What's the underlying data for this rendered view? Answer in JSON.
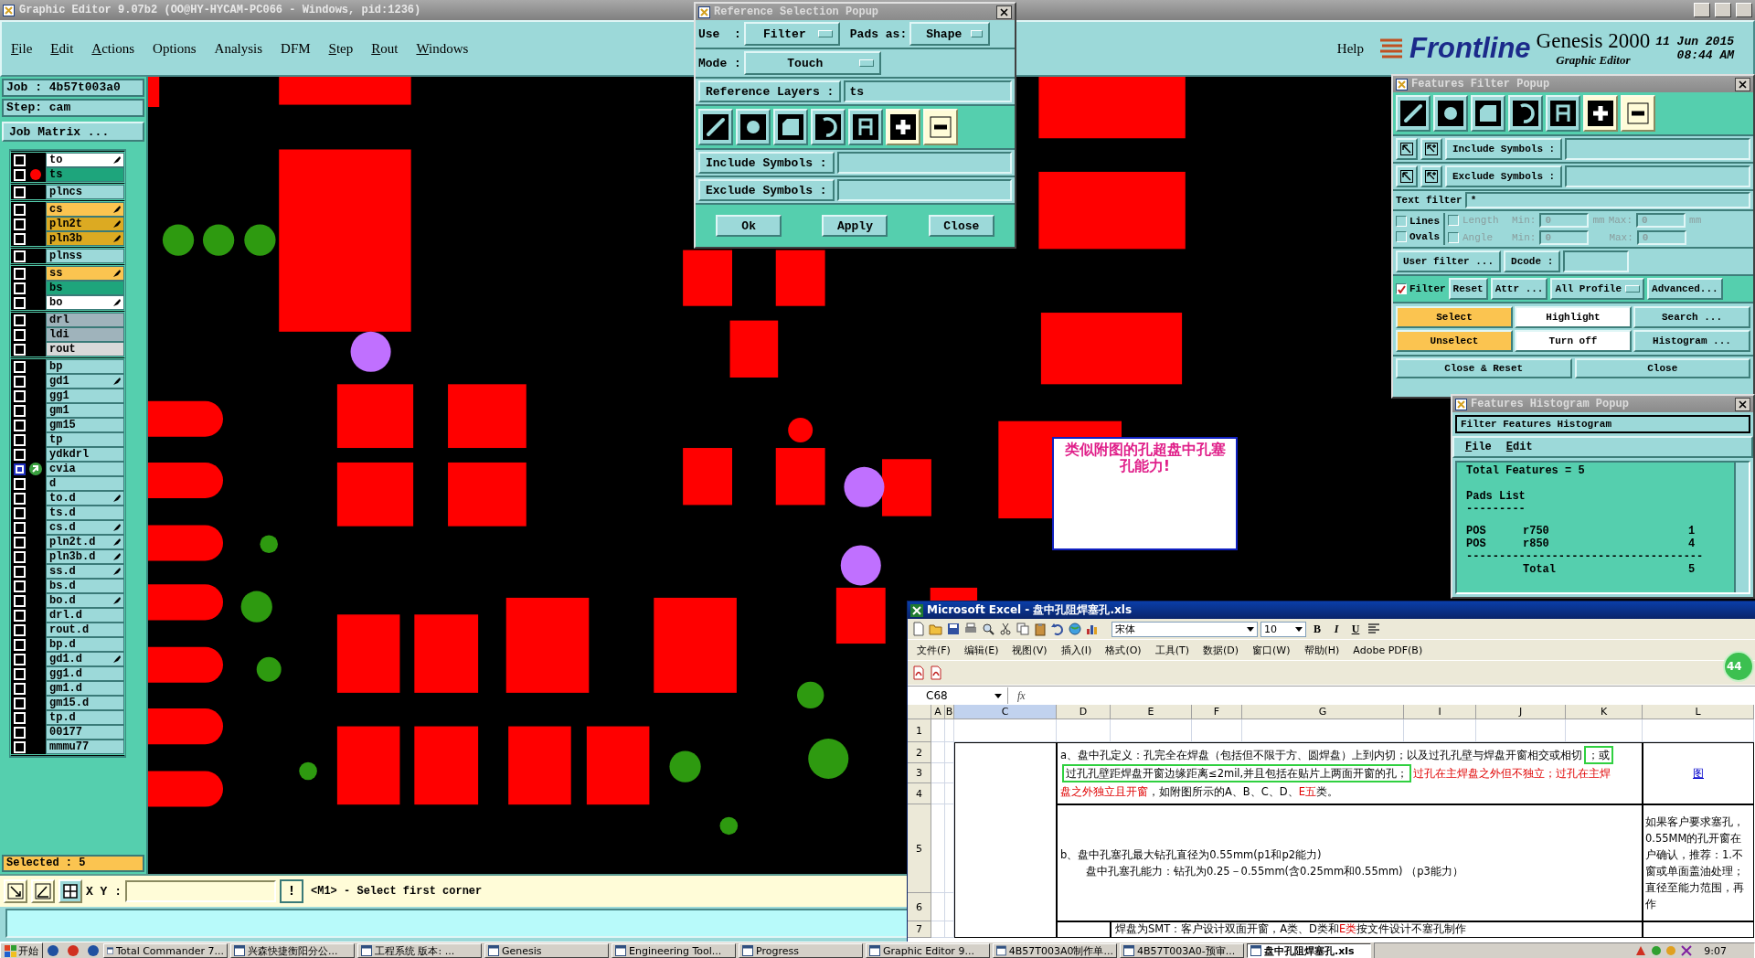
{
  "main_window": {
    "title": "Graphic Editor 9.07b2 (OO@HY-HYCAM-PC066 - Windows, pid:1236)"
  },
  "menu": [
    {
      "label": "File",
      "underlined": true
    },
    {
      "label": "Edit",
      "underlined": true
    },
    {
      "label": "Actions",
      "underlined": true
    },
    {
      "label": "Options",
      "underlined": false
    },
    {
      "label": "Analysis",
      "underlined": false
    },
    {
      "label": "DFM",
      "underlined": false
    },
    {
      "label": "Step",
      "underlined": true
    },
    {
      "label": "Rout",
      "underlined": true
    },
    {
      "label": "Windows",
      "underlined": true
    }
  ],
  "help": "Help",
  "brand": {
    "logo": "Frontline",
    "product": "Genesis 2000",
    "subtitle": "Graphic Editor",
    "date": "11 Jun 2015",
    "time": "08:44 AM"
  },
  "job": {
    "job": "Job : 4b57t003a0",
    "step": "Step: cam",
    "matrix_button": "Job Matrix ..."
  },
  "layer_groups": [
    {
      "layers": [
        {
          "name": "to",
          "color": "#ffffff",
          "work": false,
          "displayed": false,
          "marked": true
        },
        {
          "name": "ts",
          "color": "#1ea57c",
          "work": true,
          "displayed": false,
          "marked": false
        }
      ]
    },
    {
      "layers": [
        {
          "name": "plncs",
          "color": "#9cd9d9",
          "work": false,
          "displayed": false,
          "marked": false
        }
      ]
    },
    {
      "layers": [
        {
          "name": "cs",
          "color": "#fbc450",
          "work": false,
          "displayed": false,
          "marked": true
        },
        {
          "name": "pln2t",
          "color": "#dcaa22",
          "work": false,
          "displayed": false,
          "marked": true
        },
        {
          "name": "pln3b",
          "color": "#dcaa22",
          "work": false,
          "displayed": false,
          "marked": true
        }
      ]
    },
    {
      "layers": [
        {
          "name": "plnss",
          "color": "#9cd9d9",
          "work": false,
          "displayed": false,
          "marked": false
        }
      ]
    },
    {
      "layers": [
        {
          "name": "ss",
          "color": "#fbc450",
          "work": false,
          "displayed": false,
          "marked": true
        },
        {
          "name": "bs",
          "color": "#1ea57c",
          "work": false,
          "displayed": false,
          "marked": false
        },
        {
          "name": "bo",
          "color": "#ffffff",
          "work": false,
          "displayed": false,
          "marked": true
        }
      ]
    },
    {
      "layers": [
        {
          "name": "drl",
          "color": "#9fb3bb",
          "work": false,
          "displayed": false,
          "marked": false
        },
        {
          "name": "ldi",
          "color": "#9fb3bb",
          "work": false,
          "displayed": false,
          "marked": false
        },
        {
          "name": "rout",
          "color": "#d9d9d9",
          "work": false,
          "displayed": false,
          "marked": false
        }
      ]
    },
    {
      "layers": [
        {
          "name": "bp",
          "color": "#9cd9d9",
          "work": false,
          "displayed": false,
          "marked": false
        },
        {
          "name": "gd1",
          "color": "#9cd9d9",
          "work": false,
          "displayed": false,
          "marked": true
        },
        {
          "name": "gg1",
          "color": "#9cd9d9",
          "work": false,
          "displayed": false,
          "marked": false
        },
        {
          "name": "gm1",
          "color": "#9cd9d9",
          "work": false,
          "displayed": false,
          "marked": false
        },
        {
          "name": "gm15",
          "color": "#9cd9d9",
          "work": false,
          "displayed": false,
          "marked": false
        },
        {
          "name": "tp",
          "color": "#9cd9d9",
          "work": false,
          "displayed": false,
          "marked": false
        },
        {
          "name": "ydkdrl",
          "color": "#9cd9d9",
          "work": false,
          "displayed": false,
          "marked": false
        },
        {
          "name": "cvia",
          "color": "#9cd9d9",
          "work": false,
          "displayed": true,
          "marked": false
        },
        {
          "name": "d",
          "color": "#9cd9d9",
          "work": false,
          "displayed": false,
          "marked": false
        },
        {
          "name": "to.d",
          "color": "#9cd9d9",
          "work": false,
          "displayed": false,
          "marked": true
        },
        {
          "name": "ts.d",
          "color": "#9cd9d9",
          "work": false,
          "displayed": false,
          "marked": false
        },
        {
          "name": "cs.d",
          "color": "#9cd9d9",
          "work": false,
          "displayed": false,
          "marked": true
        },
        {
          "name": "pln2t.d",
          "color": "#9cd9d9",
          "work": false,
          "displayed": false,
          "marked": true
        },
        {
          "name": "pln3b.d",
          "color": "#9cd9d9",
          "work": false,
          "displayed": false,
          "marked": true
        },
        {
          "name": "ss.d",
          "color": "#9cd9d9",
          "work": false,
          "displayed": false,
          "marked": true
        },
        {
          "name": "bs.d",
          "color": "#9cd9d9",
          "work": false,
          "displayed": false,
          "marked": false
        },
        {
          "name": "bo.d",
          "color": "#9cd9d9",
          "work": false,
          "displayed": false,
          "marked": true
        },
        {
          "name": "drl.d",
          "color": "#9cd9d9",
          "work": false,
          "displayed": false,
          "marked": false
        },
        {
          "name": "rout.d",
          "color": "#9cd9d9",
          "work": false,
          "displayed": false,
          "marked": false
        },
        {
          "name": "bp.d",
          "color": "#9cd9d9",
          "work": false,
          "displayed": false,
          "marked": false
        },
        {
          "name": "gd1.d",
          "color": "#9cd9d9",
          "work": false,
          "displayed": false,
          "marked": true
        },
        {
          "name": "gg1.d",
          "color": "#9cd9d9",
          "work": false,
          "displayed": false,
          "marked": false
        },
        {
          "name": "gm1.d",
          "color": "#9cd9d9",
          "work": false,
          "displayed": false,
          "marked": false
        },
        {
          "name": "gm15.d",
          "color": "#9cd9d9",
          "work": false,
          "displayed": false,
          "marked": false
        },
        {
          "name": "tp.d",
          "color": "#9cd9d9",
          "work": false,
          "displayed": false,
          "marked": false
        },
        {
          "name": "00177",
          "color": "#9cd9d9",
          "work": false,
          "displayed": false,
          "marked": false
        },
        {
          "name": "mmmu77",
          "color": "#9cd9d9",
          "work": false,
          "displayed": false,
          "marked": false
        }
      ]
    }
  ],
  "selected": "Selected : 5",
  "canvas_note": "类似附图的孔超盘中孔塞孔能力!",
  "command_bar": {
    "xy_label": "X Y :",
    "alert": "!",
    "prompt": "<M1> - Select first corner"
  },
  "reference_popup": {
    "title": "Reference Selection Popup",
    "use_label": "Use  :",
    "use_value": "Filter",
    "pads_label": "Pads as:",
    "pads_value": "Shape",
    "mode_label": "Mode :",
    "mode_value": "Touch",
    "layers_button": "Reference Layers :",
    "layers_value": "ts",
    "types": [
      {
        "kind": "line"
      },
      {
        "kind": "pad"
      },
      {
        "kind": "surface"
      },
      {
        "kind": "arc"
      },
      {
        "kind": "text"
      },
      {
        "kind": "positive"
      },
      {
        "kind": "negative"
      }
    ],
    "include_button": "Include Symbols :",
    "exclude_button": "Exclude Symbols :",
    "buttons": [
      "Ok",
      "Apply",
      "Close"
    ]
  },
  "filter_popup": {
    "title": "Features Filter Popup",
    "types": [
      {
        "kind": "line"
      },
      {
        "kind": "pad"
      },
      {
        "kind": "surface"
      },
      {
        "kind": "arc"
      },
      {
        "kind": "text"
      },
      {
        "kind": "positive"
      },
      {
        "kind": "negative"
      }
    ],
    "include_label": "Include Symbols :",
    "exclude_label": "Exclude Symbols :",
    "text_filter_label": "Text filter",
    "text_filter_value": "*",
    "lines": {
      "label": "Lines",
      "checked": false
    },
    "ovals": {
      "label": "Ovals",
      "checked": false
    },
    "length": {
      "label": "Length",
      "checked": false,
      "disabled": true,
      "min_label": "Min:",
      "min": "0",
      "min_unit": "mm",
      "max_label": "Max:",
      "max": "0",
      "max_unit": "mm"
    },
    "angle": {
      "label": "Angle",
      "checked": false,
      "disabled": true,
      "min_label": "Min:",
      "min": "0",
      "max_label": "Max:",
      "max": "0"
    },
    "user_filter": "User filter ...",
    "dcode_label": "Dcode :",
    "filter": {
      "label": "Filter",
      "checked": true
    },
    "reset": "Reset",
    "attr": "Attr ...",
    "profile": "All Profile",
    "advanced": "Advanced...",
    "actions": [
      {
        "label": "Select",
        "kind": "primary"
      },
      {
        "label": "Highlight",
        "kind": "plain"
      },
      {
        "label": "Search ...",
        "kind": "normal"
      },
      {
        "label": "Unselect",
        "kind": "primary"
      },
      {
        "label": "Turn off",
        "kind": "plain"
      },
      {
        "label": "Histogram ...",
        "kind": "normal"
      }
    ],
    "close_reset": "Close & Reset",
    "close": "Close"
  },
  "histogram_popup": {
    "title": "Features Histogram Popup",
    "heading": "Filter Features Histogram",
    "menu": [
      "File",
      "Edit"
    ],
    "total": "Total Features = 5",
    "section": "Pads List",
    "section_rule": "---------",
    "rows": [
      {
        "type": "POS",
        "symbol": "r750",
        "count": "1"
      },
      {
        "type": "POS",
        "symbol": "r850",
        "count": "4"
      }
    ],
    "rule": "------------------------------------",
    "total_label": "Total",
    "total_count": "5"
  },
  "excel": {
    "title": "Microsoft Excel - 盘中孔阻焊塞孔.xls",
    "font": "宋体",
    "font_size": "10",
    "format_buttons": [
      "B",
      "I",
      "U"
    ],
    "menu": [
      "文件(F)",
      "编辑(E)",
      "视图(V)",
      "插入(I)",
      "格式(O)",
      "工具(T)",
      "数据(D)",
      "窗口(W)",
      "帮助(H)",
      "Adobe PDF(B)"
    ],
    "name_box": "C68",
    "fx": "fx",
    "columns": [
      {
        "label": "A",
        "selected": false
      },
      {
        "label": "B",
        "selected": false
      },
      {
        "label": "C",
        "selected": true
      },
      {
        "label": "D",
        "selected": false
      },
      {
        "label": "E",
        "selected": false
      },
      {
        "label": "F",
        "selected": false
      },
      {
        "label": "G",
        "selected": false
      },
      {
        "label": "I",
        "selected": false
      },
      {
        "label": "J",
        "selected": false
      },
      {
        "label": "K",
        "selected": false
      },
      {
        "label": "L",
        "selected": false
      }
    ],
    "rows": [
      "1",
      "2",
      "3",
      "4",
      "5",
      "6",
      "7"
    ],
    "cell_a": [
      {
        "segments": [
          {
            "text": "a、盘中孔定义：孔完全在焊盘（包括但不限于方、圆焊盘）上到内切；以及过孔孔壁与焊盘开窗相交或相切",
            "red": false,
            "framed": false
          },
          {
            "text": "；或",
            "red": false,
            "framed": true
          }
        ]
      },
      {
        "segments": [
          {
            "text": "过孔孔壁距焊盘开窗边缘距离≤2mil,并且包括在贴片上两面开窗的孔；",
            "red": false,
            "framed": true
          },
          {
            "text": "过孔在主焊盘之外但不独立；过孔在主焊",
            "red": true,
            "framed": false
          }
        ]
      },
      {
        "segments": [
          {
            "text": "盘之外独立且开窗",
            "red": true,
            "framed": false
          },
          {
            "text": "，如附图所示的A、B、C、D、",
            "red": false,
            "framed": false
          },
          {
            "text": "E五",
            "red": true,
            "framed": false
          },
          {
            "text": "类。",
            "red": false,
            "framed": false
          }
        ]
      }
    ],
    "link": "图",
    "cell_b": [
      "b、盘中孔塞孔最大钻孔直径为0.55mm(p1和p2能力)",
      "盘中孔塞孔能力：钻孔为0.25－0.55mm(含0.25mm和0.55mm) （p3能力）"
    ],
    "note_lines": [
      "如果客户要求塞孔，",
      "0.55MM的孔开窗在",
      "户确认，推荐：1.不",
      "窗或单面盖油处理；",
      "直径至能力范围，再",
      "作"
    ],
    "cell_row7": [
      {
        "text": "焊盘为SMT：客户设计双面开窗，A类、D类和",
        "red": false
      },
      {
        "text": "E类",
        "red": true
      },
      {
        "text": "按文件设计不塞孔制作",
        "red": false
      }
    ],
    "badge": "44"
  },
  "taskbar": {
    "start": "开始",
    "items": [
      {
        "label": "Total Commander 7...",
        "selected": false
      },
      {
        "label": "兴森快捷衡阳分公...",
        "selected": false
      },
      {
        "label": "工程系统    版本: ...",
        "selected": false
      },
      {
        "label": "Genesis",
        "selected": false
      },
      {
        "label": "Engineering Tool...",
        "selected": false
      },
      {
        "label": "Progress",
        "selected": false
      },
      {
        "label": "Graphic Editor 9...",
        "selected": false
      },
      {
        "label": "4B57T003A0制作单...",
        "selected": false
      },
      {
        "label": "4B57T003A0-预审...",
        "selected": false
      },
      {
        "label": "盘中孔阻焊塞孔.xls",
        "selected": true
      }
    ],
    "clock": "9:07"
  }
}
